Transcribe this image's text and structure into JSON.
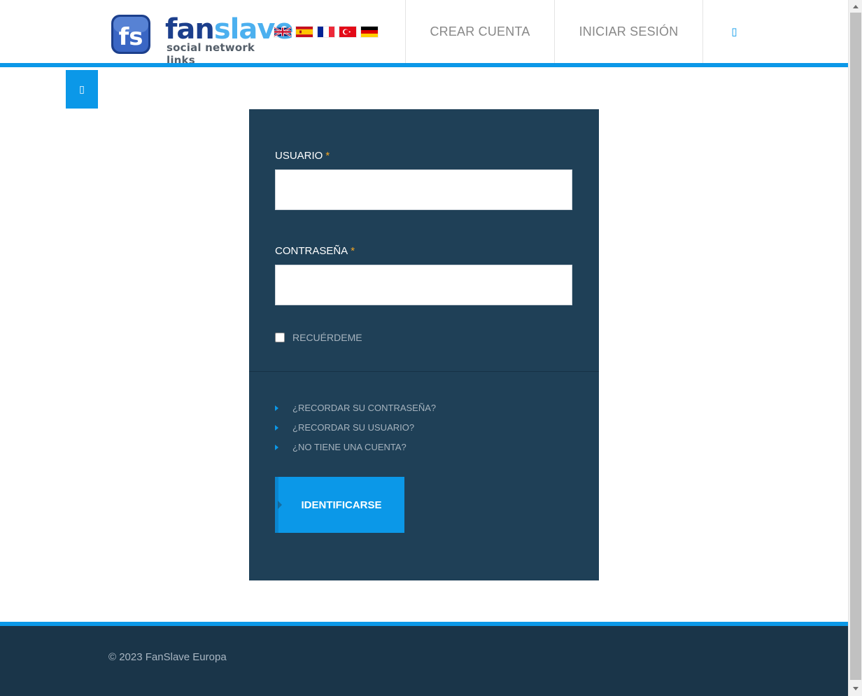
{
  "header": {
    "logo": {
      "mark_text": "fs",
      "word_part1": "fan",
      "word_part2": "slave",
      "tagline": "social network links"
    },
    "languages": [
      "english-flag",
      "spanish-flag",
      "french-flag",
      "turkish-flag",
      "german-flag"
    ],
    "nav": {
      "create_account": "CREAR CUENTA",
      "login": "INICIAR SESIÓN",
      "user_icon": "user-icon",
      "user_glyph": "▯"
    }
  },
  "side_toggle": {
    "icon": "menu-icon",
    "glyph": "▯"
  },
  "login_form": {
    "username_label": "USUARIO",
    "password_label": "CONTRASEÑA",
    "required_mark": "*",
    "username_value": "",
    "password_value": "",
    "remember_label": "RECUÉRDEME",
    "remember_checked": false,
    "links": [
      "¿RECORDAR SU CONTRASEÑA?",
      "¿RECORDAR SU USUARIO?",
      "¿NO TIENE UNA CUENTA?"
    ],
    "submit_label": "IDENTIFICARSE"
  },
  "footer": {
    "copyright": "© 2023 FanSlave Europa"
  },
  "colors": {
    "accent": "#0b98e8",
    "panel": "#1f4057",
    "footer": "#1a3549",
    "required": "#f5a623"
  }
}
